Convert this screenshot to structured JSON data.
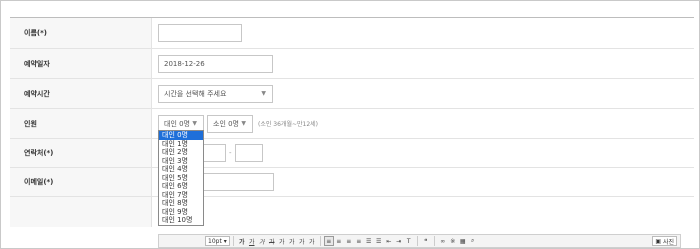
{
  "form": {
    "name_label": "이름(*)",
    "name_value": "",
    "date_label": "예약일자",
    "date_value": "2018-12-26",
    "time_label": "예약시간",
    "time_select": "시간을 선택해 주세요",
    "people_label": "인원",
    "adult_select": "대인 0명",
    "child_select": "소인 0명",
    "people_note": "(소인 36개월~만12세)",
    "contact_label": "연락처(*)",
    "contact_dash": "-",
    "email_label": "이메일(*)"
  },
  "adult_dropdown": {
    "options": [
      "대인 0명",
      "대인 1명",
      "대인 2명",
      "대인 3명",
      "대인 4명",
      "대인 5명",
      "대인 6명",
      "대인 7명",
      "대인 8명",
      "대인 9명",
      "대인 10명"
    ],
    "selected_index": 0
  },
  "editor_toolbar": {
    "font_size": "10pt",
    "bold": "가",
    "italic": "가",
    "underline": "가",
    "strike": "가",
    "font_color": "가",
    "bg_color": "가",
    "superscript": "가",
    "subscript": "가",
    "photo_label": "사진"
  },
  "colors": {
    "selected_option": "#1e6fd9",
    "label_bg": "#f7f7f7"
  }
}
